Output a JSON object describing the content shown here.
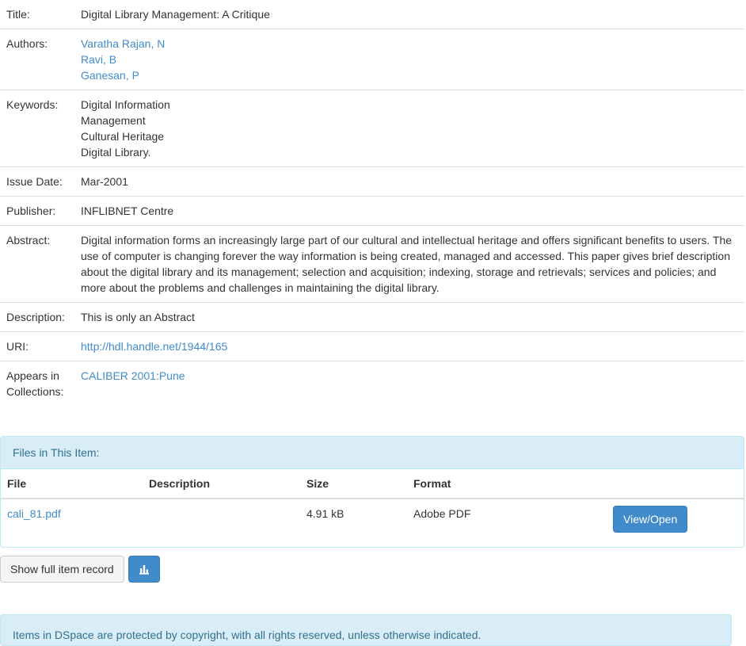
{
  "metadata": {
    "title_label": "Title:",
    "title_value": "Digital Library Management: A Critique",
    "authors_label": "Authors:",
    "authors": [
      "Varatha Rajan, N",
      "Ravi, B",
      "Ganesan, P"
    ],
    "keywords_label": "Keywords:",
    "keywords": [
      "Digital Information",
      "Management",
      "Cultural Heritage",
      "Digital Library."
    ],
    "issue_date_label": "Issue Date:",
    "issue_date_value": "Mar-2001",
    "publisher_label": "Publisher:",
    "publisher_value": "INFLIBNET Centre",
    "abstract_label": "Abstract:",
    "abstract_value": "Digital information forms an increasingly large part of our cultural and intellectual heritage and offers significant benefits to users. The use of computer is changing forever the way information is being created, managed and accessed. This paper gives brief description about the digital library and its management; selection and acquisition; indexing, storage and retrievals; services and policies; and more about the problems and challenges in maintaining the digital library.",
    "description_label": "Description:",
    "description_value": "This is only an Abstract",
    "uri_label": "URI:",
    "uri_value": "http://hdl.handle.net/1944/165",
    "collections_label": "Appears in Collections:",
    "collections_value": "CALIBER 2001:Pune"
  },
  "files_panel": {
    "heading": "Files in This Item:",
    "columns": [
      "File",
      "Description",
      "Size",
      "Format"
    ],
    "rows": [
      {
        "file": "cali_81.pdf",
        "description": "",
        "size": "4.91 kB",
        "format": "Adobe PDF",
        "action": "View/Open"
      }
    ]
  },
  "actions": {
    "full_record_label": "Show full item record",
    "stats_icon": "bar-chart-icon"
  },
  "copyright_notice": "Items in DSpace are protected by copyright, with all rights reserved, unless otherwise indicated.",
  "colors": {
    "link": "#428bca",
    "primary_button": "#428bca",
    "panel_heading_bg": "#d9edf7",
    "panel_heading_text": "#31708f"
  }
}
